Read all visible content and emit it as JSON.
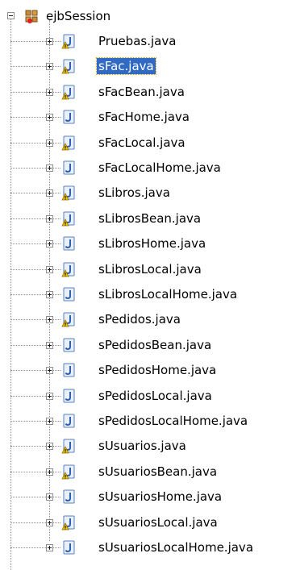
{
  "package": {
    "name": "ejbSession",
    "expanded": true
  },
  "files": [
    {
      "name": "Pruebas.java",
      "warning": true,
      "selected": false
    },
    {
      "name": "sFac.java",
      "warning": true,
      "selected": true
    },
    {
      "name": "sFacBean.java",
      "warning": true,
      "selected": false
    },
    {
      "name": "sFacHome.java",
      "warning": false,
      "selected": false
    },
    {
      "name": "sFacLocal.java",
      "warning": true,
      "selected": false
    },
    {
      "name": "sFacLocalHome.java",
      "warning": false,
      "selected": false
    },
    {
      "name": "sLibros.java",
      "warning": true,
      "selected": false
    },
    {
      "name": "sLibrosBean.java",
      "warning": true,
      "selected": false
    },
    {
      "name": "sLibrosHome.java",
      "warning": false,
      "selected": false
    },
    {
      "name": "sLibrosLocal.java",
      "warning": true,
      "selected": false
    },
    {
      "name": "sLibrosLocalHome.java",
      "warning": false,
      "selected": false
    },
    {
      "name": "sPedidos.java",
      "warning": true,
      "selected": false
    },
    {
      "name": "sPedidosBean.java",
      "warning": false,
      "selected": false
    },
    {
      "name": "sPedidosHome.java",
      "warning": false,
      "selected": false
    },
    {
      "name": "sPedidosLocal.java",
      "warning": false,
      "selected": false
    },
    {
      "name": "sPedidosLocalHome.java",
      "warning": false,
      "selected": false
    },
    {
      "name": "sUsuarios.java",
      "warning": true,
      "selected": false
    },
    {
      "name": "sUsuariosBean.java",
      "warning": true,
      "selected": false
    },
    {
      "name": "sUsuariosHome.java",
      "warning": false,
      "selected": false
    },
    {
      "name": "sUsuariosLocal.java",
      "warning": true,
      "selected": false
    },
    {
      "name": "sUsuariosLocalHome.java",
      "warning": false,
      "selected": false
    }
  ],
  "colors": {
    "selection": "#316ac5",
    "java_icon_blue": "#2d5fb3",
    "warning_yellow": "#f5c400"
  }
}
